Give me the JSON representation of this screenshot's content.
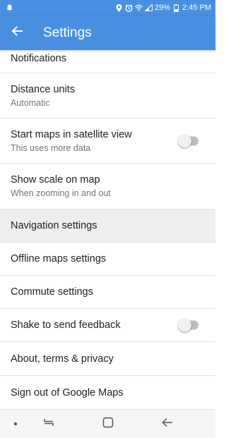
{
  "status_bar": {
    "battery_percent": "29%",
    "time": "2:45 PM",
    "icons": [
      "notification-icon",
      "location-icon",
      "alarm-icon",
      "wifi-icon",
      "signal-icon",
      "battery-icon"
    ]
  },
  "app_bar": {
    "title": "Settings",
    "back_icon": "arrow-back-icon",
    "background": "#4a90e2"
  },
  "settings": {
    "items": [
      {
        "label": "Notifications"
      },
      {
        "label": "Distance units",
        "sublabel": "Automatic"
      },
      {
        "label": "Start maps in satellite view",
        "sublabel": "This uses more data",
        "toggle": false
      },
      {
        "label": "Show scale on map",
        "sublabel": "When zooming in and out"
      },
      {
        "label": "Navigation settings"
      },
      {
        "label": "Offline maps settings"
      },
      {
        "label": "Commute settings"
      },
      {
        "label": "Shake to send feedback",
        "toggle": false
      },
      {
        "label": "About, terms & privacy"
      },
      {
        "label": "Sign out of Google Maps"
      }
    ]
  },
  "nav_bar": {
    "icons": [
      "dot-icon",
      "recent-apps-icon",
      "home-icon",
      "back-icon"
    ]
  }
}
